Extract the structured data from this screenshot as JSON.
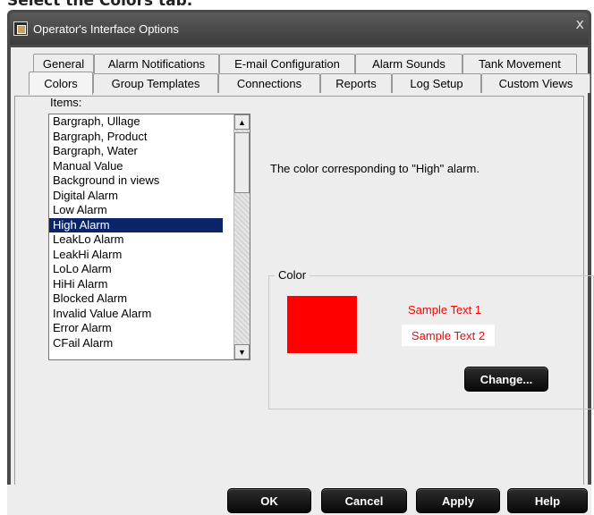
{
  "caption": "Select the Colors tab.",
  "window": {
    "title": "Operator's Interface Options",
    "close": "x"
  },
  "tabs": {
    "back_row": [
      "General",
      "Alarm Notifications",
      "E-mail Configuration",
      "Alarm Sounds",
      "Tank Movement"
    ],
    "front_row": [
      "Colors",
      "Group Templates",
      "Connections",
      "Reports",
      "Log Setup",
      "Custom Views"
    ],
    "active": "Colors"
  },
  "items": {
    "label": "Items:",
    "list": [
      "Bargraph, Ullage",
      "Bargraph, Product",
      "Bargraph, Water",
      "Manual Value",
      "Background in views",
      "Digital Alarm",
      "Low Alarm",
      "High Alarm",
      "LeakLo Alarm",
      "LeakHi Alarm",
      "LoLo Alarm",
      "HiHi Alarm",
      "Blocked Alarm",
      "Invalid Value Alarm",
      "Error Alarm",
      "CFail Alarm"
    ],
    "selected_index": 7
  },
  "description": "The color corresponding to \"High\" alarm.",
  "color_box": {
    "legend": "Color",
    "swatch_color": "#ff0000",
    "sample1": "Sample Text 1",
    "sample2": "Sample Text 2",
    "change_label": "Change..."
  },
  "buttons": {
    "ok": "OK",
    "cancel": "Cancel",
    "apply": "Apply",
    "help": "Help"
  }
}
